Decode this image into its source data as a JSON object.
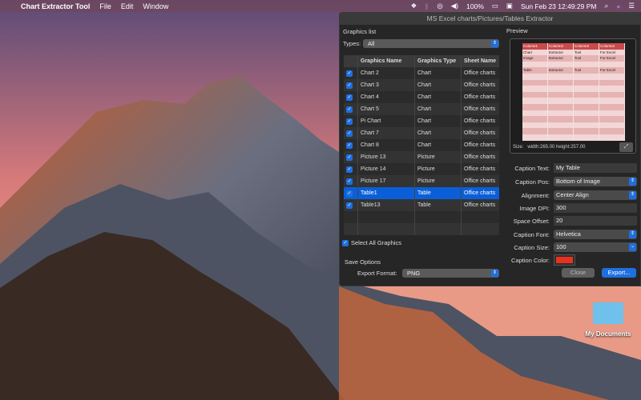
{
  "menubar": {
    "apple": "",
    "app_name": "Chart Extractor Tool",
    "menus": [
      "File",
      "Edit",
      "Window"
    ],
    "battery": "100%",
    "datetime": "Sun Feb 23  12:49:29 PM"
  },
  "window": {
    "title": "MS Excel charts/Pictures/Tables Extractor"
  },
  "graphics": {
    "title": "Graphics list",
    "types_label": "Types:",
    "types_value": "All",
    "columns": [
      "Graphics Name",
      "Graphics Type",
      "Sheet Name"
    ],
    "rows": [
      {
        "name": "Chart 2",
        "type": "Chart",
        "sheet": "Office charts",
        "checked": true
      },
      {
        "name": "Chart 3",
        "type": "Chart",
        "sheet": "Office charts",
        "checked": true
      },
      {
        "name": "Chart 4",
        "type": "Chart",
        "sheet": "Office charts",
        "checked": true
      },
      {
        "name": "Chart 5",
        "type": "Chart",
        "sheet": "Office charts",
        "checked": true
      },
      {
        "name": "Pi Chart",
        "type": "Chart",
        "sheet": "Office charts",
        "checked": true
      },
      {
        "name": "Chart 7",
        "type": "Chart",
        "sheet": "Office charts",
        "checked": true
      },
      {
        "name": "Chart 8",
        "type": "Chart",
        "sheet": "Office charts",
        "checked": true
      },
      {
        "name": "Picture 13",
        "type": "Picture",
        "sheet": "Office charts",
        "checked": true
      },
      {
        "name": "Picture 14",
        "type": "Picture",
        "sheet": "Office charts",
        "checked": true
      },
      {
        "name": "Picture 17",
        "type": "Picture",
        "sheet": "Office charts",
        "checked": true
      },
      {
        "name": "Table1",
        "type": "Table",
        "sheet": "Office charts",
        "checked": true,
        "selected": true
      },
      {
        "name": "Table13",
        "type": "Table",
        "sheet": "Office charts",
        "checked": true
      }
    ],
    "select_all": "Select All Graphics"
  },
  "save": {
    "title": "Save Options",
    "format_label": "Export Format:",
    "format_value": "PNG"
  },
  "preview": {
    "title": "Preview",
    "size_label": "Size:",
    "size_value": "width:265.00  height:257.00",
    "table": [
      [
        "Column1",
        "Column2",
        "Column3",
        "Column4"
      ],
      [
        "Chart",
        "Extractor",
        "Tool",
        "For Excel"
      ],
      [
        "Image",
        "Extractor",
        "Tool",
        "For Excel"
      ],
      [
        "",
        "",
        "",
        ""
      ],
      [
        "Table",
        "Extractor",
        "Tool",
        "For Excel"
      ]
    ]
  },
  "form": {
    "caption_text": {
      "label": "Caption Text:",
      "value": "My Table"
    },
    "caption_pos": {
      "label": "Caption Pos:",
      "value": "Bottom of Image"
    },
    "alignment": {
      "label": "Alignment:",
      "value": "Center Align"
    },
    "dpi": {
      "label": "Image DPI:",
      "value": "300"
    },
    "offset": {
      "label": "Space Offset:",
      "value": "20"
    },
    "font": {
      "label": "Caption Font:",
      "value": "Helvetica"
    },
    "size": {
      "label": "Caption Size:",
      "value": "100"
    },
    "color": {
      "label": "Caption Color:",
      "value": "#e8321e"
    }
  },
  "buttons": {
    "close": "Close",
    "export": "Export..."
  },
  "desktop": {
    "folder_label": "My Documents"
  }
}
